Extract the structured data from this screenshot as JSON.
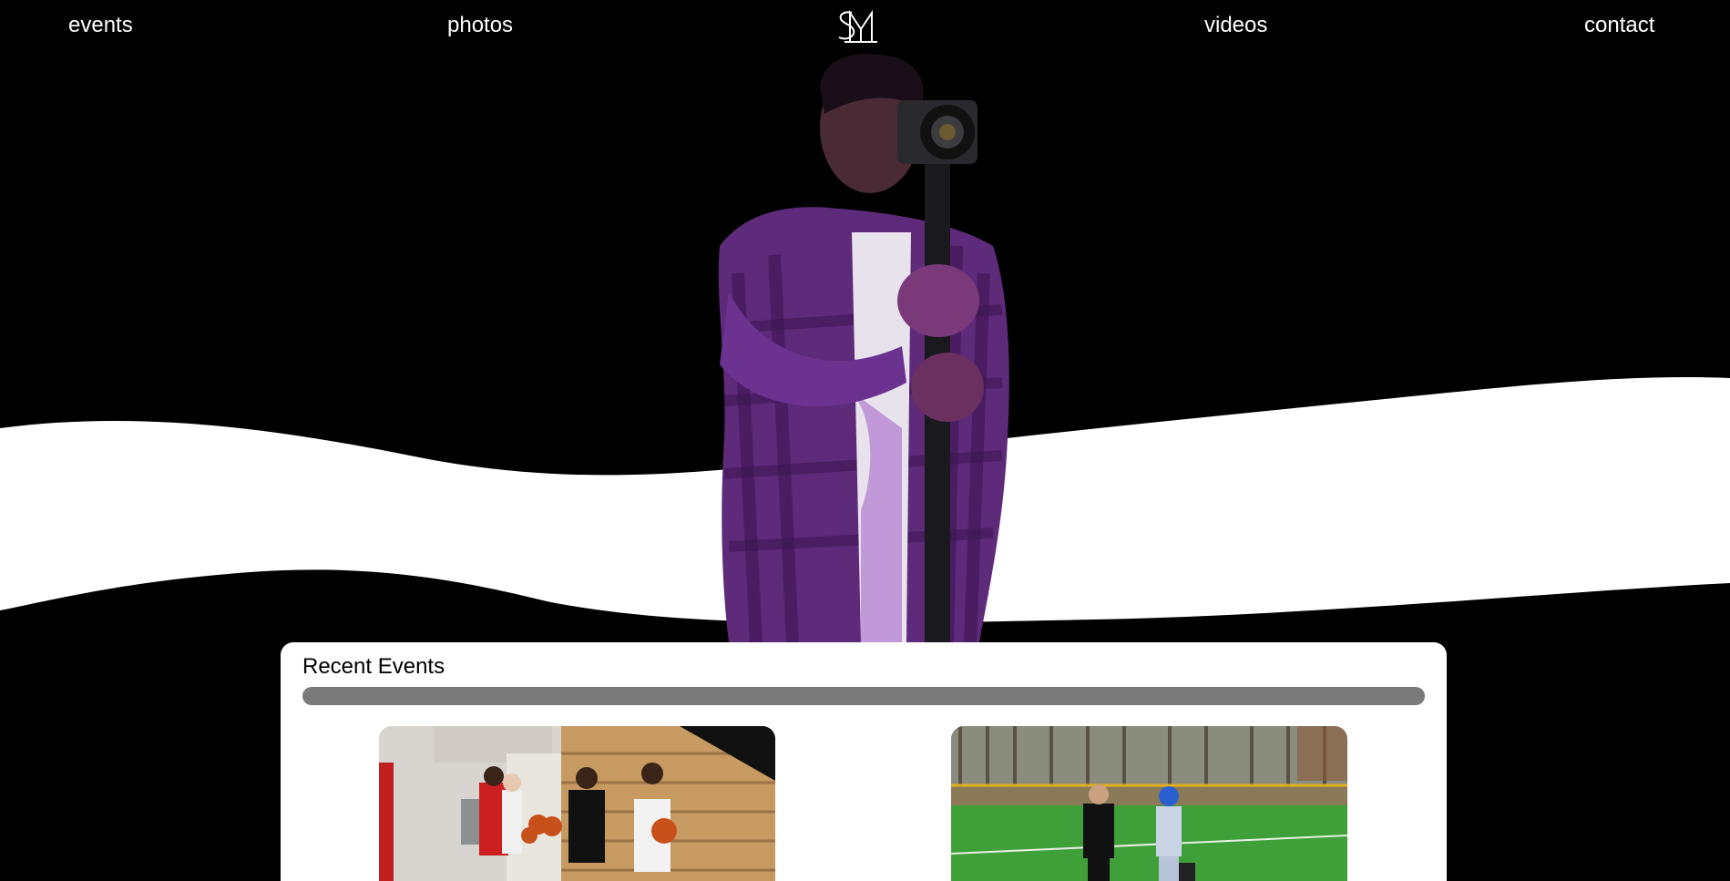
{
  "nav": {
    "left_links": [
      {
        "label": "events"
      },
      {
        "label": "photos"
      }
    ],
    "right_links": [
      {
        "label": "videos"
      },
      {
        "label": "contact"
      }
    ],
    "logo_icon": "sm-monogram-logo"
  },
  "hero": {
    "image_subject": "camera-operator-with-gimbal",
    "colors": {
      "background": "#000000",
      "wave": "#ffffff",
      "accent": "#8a2be2"
    }
  },
  "recent_events": {
    "title": "Recent Events",
    "bar_color": "#7a7a7a",
    "events": [
      {
        "image": "basketball-players-photo"
      },
      {
        "image": "field-athletes-photo"
      }
    ]
  }
}
